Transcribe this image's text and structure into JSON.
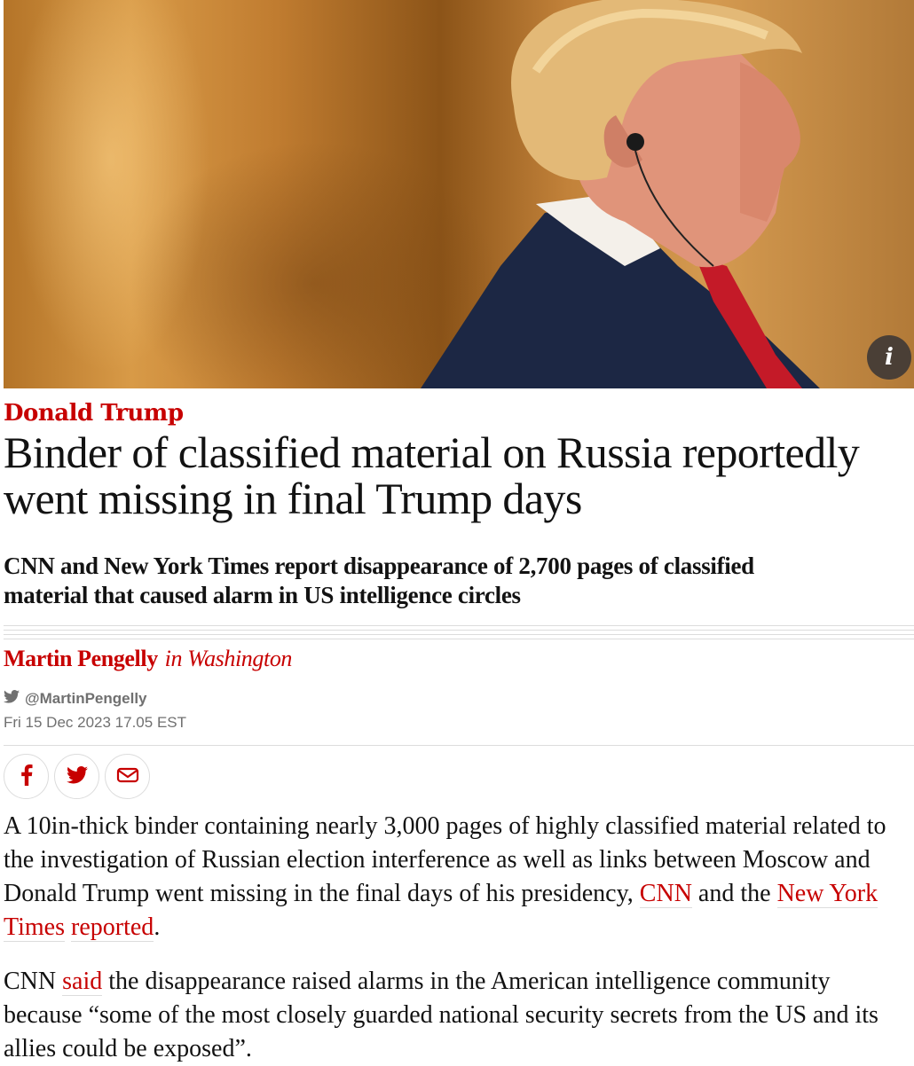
{
  "image": {
    "info_label": "i"
  },
  "article": {
    "kicker": "Donald Trump",
    "headline": "Binder of classified material on Russia reportedly went missing in final Trump days",
    "standfirst": "CNN and New York Times report disappearance of 2,700 pages of classified material that caused alarm in US intelligence circles",
    "byline": {
      "author": "Martin Pengelly",
      "location": "in Washington"
    },
    "twitter_handle": "@MartinPengelly",
    "dateline": "Fri 15 Dec 2023 17.05 EST",
    "share": {
      "icons": [
        "facebook-icon",
        "twitter-icon",
        "email-icon"
      ]
    },
    "paragraphs": [
      {
        "text_a": "A 10in-thick binder containing nearly 3,000 pages of highly classified material related to the investigation of Russian election interference as well as links between Moscow and Donald Trump went missing in the final days of his presidency, ",
        "link_a": "CNN",
        "text_b": " and the ",
        "link_b": "New York Times",
        "text_c": " ",
        "link_c": "reported",
        "text_d": "."
      },
      {
        "text_a": "CNN ",
        "link_a": "said",
        "text_b": " the disappearance raised alarms in the American intelligence community because “some of the most closely guarded national security secrets from the US and its allies could be exposed”."
      }
    ]
  },
  "colors": {
    "accent": "#c70000",
    "text": "#121212",
    "muted": "#707070",
    "rule": "#dcdcdc"
  }
}
